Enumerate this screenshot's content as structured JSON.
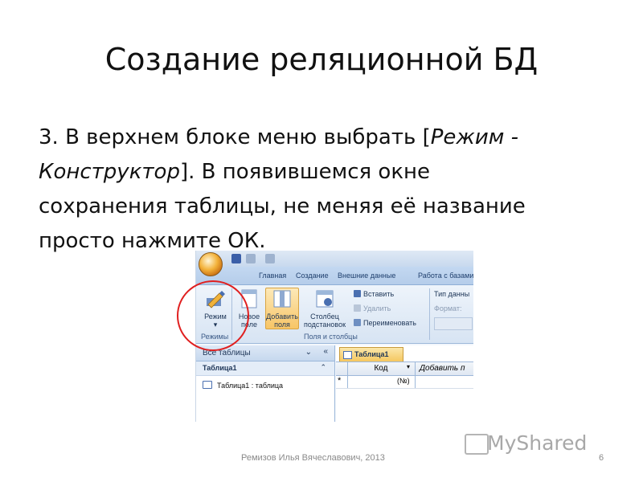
{
  "slide": {
    "title": "Создание реляционной БД",
    "body_1": "3. В верхнем блоке меню выбрать [",
    "body_italic_1": "Режим -",
    "body_italic_2": "Конструктор",
    "body_2": "]. В появившемся окне",
    "body_3": "сохранения таблицы, не меняя её название",
    "body_4": "просто нажмите ОК.",
    "footer_author": "Ремизов Илья Вячеславович, 2013",
    "page_number": "6",
    "watermark": "MyShared"
  },
  "access": {
    "tabs": [
      "Главная",
      "Создание",
      "Внешние данные",
      "Работа с базами"
    ],
    "ribbon": {
      "mode_button": "Режим",
      "new_field": "Новое поле",
      "add_fields": "Добавить поля",
      "column_subst": "Столбец подстановок",
      "insert": "Вставить",
      "delete": "Удалить",
      "rename": "Переименовать",
      "data_type": "Тип данны",
      "format": "Формат:",
      "group_modes": "Режимы",
      "group_fields": "Поля и столбцы"
    },
    "nav": {
      "header": "Все таблицы",
      "group": "Таблица1",
      "item": "Таблица1 : таблица"
    },
    "grid": {
      "tab": "Таблица1",
      "col_code": "Код",
      "col_add": "Добавить п",
      "new_row_marker": "*",
      "new_row_value": "(№)"
    }
  },
  "colors": {
    "highlight_circle": "#e02020",
    "ribbon_blue": "#c3d8f1",
    "active_orange": "#f5c760"
  }
}
